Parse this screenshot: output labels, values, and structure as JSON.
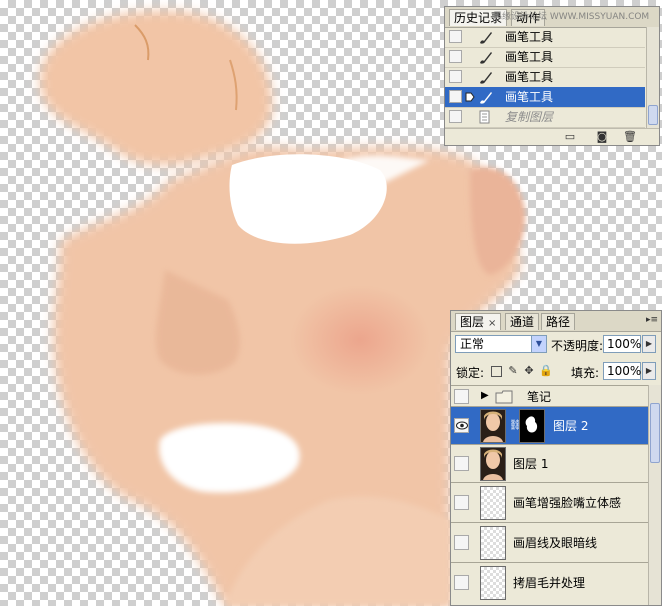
{
  "history_panel": {
    "tabs": [
      {
        "label": "历史记录"
      },
      {
        "label": "动作"
      }
    ],
    "watermark": "思缘设计论坛 WWW.MISSYUAN.COM",
    "items": [
      {
        "label": "画笔工具",
        "icon": "brush-icon",
        "state": "normal"
      },
      {
        "label": "画笔工具",
        "icon": "brush-icon",
        "state": "normal"
      },
      {
        "label": "画笔工具",
        "icon": "brush-icon",
        "state": "normal"
      },
      {
        "label": "画笔工具",
        "icon": "brush-icon",
        "state": "selected"
      },
      {
        "label": "复制图层",
        "icon": "duplicate-layer-icon",
        "state": "undone"
      }
    ],
    "footer_icons": [
      "new-document-from-state-icon",
      "camera-snapshot-icon",
      "trash-icon"
    ]
  },
  "layers_panel": {
    "tabs": [
      {
        "label": "图层",
        "close": "×"
      },
      {
        "label": "通道"
      },
      {
        "label": "路径"
      }
    ],
    "blend_mode": "正常",
    "opacity_label": "不透明度:",
    "opacity_value": "100%",
    "lock_label": "锁定:",
    "fill_label": "填充:",
    "fill_value": "100%",
    "lock_icons": [
      "lock-transparency-icon",
      "lock-pixels-icon",
      "lock-position-icon",
      "lock-all-icon"
    ],
    "layers": [
      {
        "name": "笔记",
        "kind": "group",
        "selected": false,
        "visible": false
      },
      {
        "name": "图层 2",
        "kind": "masked",
        "selected": true,
        "visible": true
      },
      {
        "name": "图层 1",
        "kind": "photo",
        "selected": false,
        "visible": false
      },
      {
        "name": "画笔增强脸嘴立体感",
        "kind": "transparent",
        "selected": false,
        "visible": false
      },
      {
        "name": "画眉线及眼暗线",
        "kind": "transparent",
        "selected": false,
        "visible": false
      },
      {
        "name": "拷眉毛并处理",
        "kind": "transparent",
        "selected": false,
        "visible": false
      }
    ]
  },
  "colors": {
    "panel_bg": "#ece9d8",
    "selection": "#316ac5",
    "skin": "#f0c4a6"
  }
}
